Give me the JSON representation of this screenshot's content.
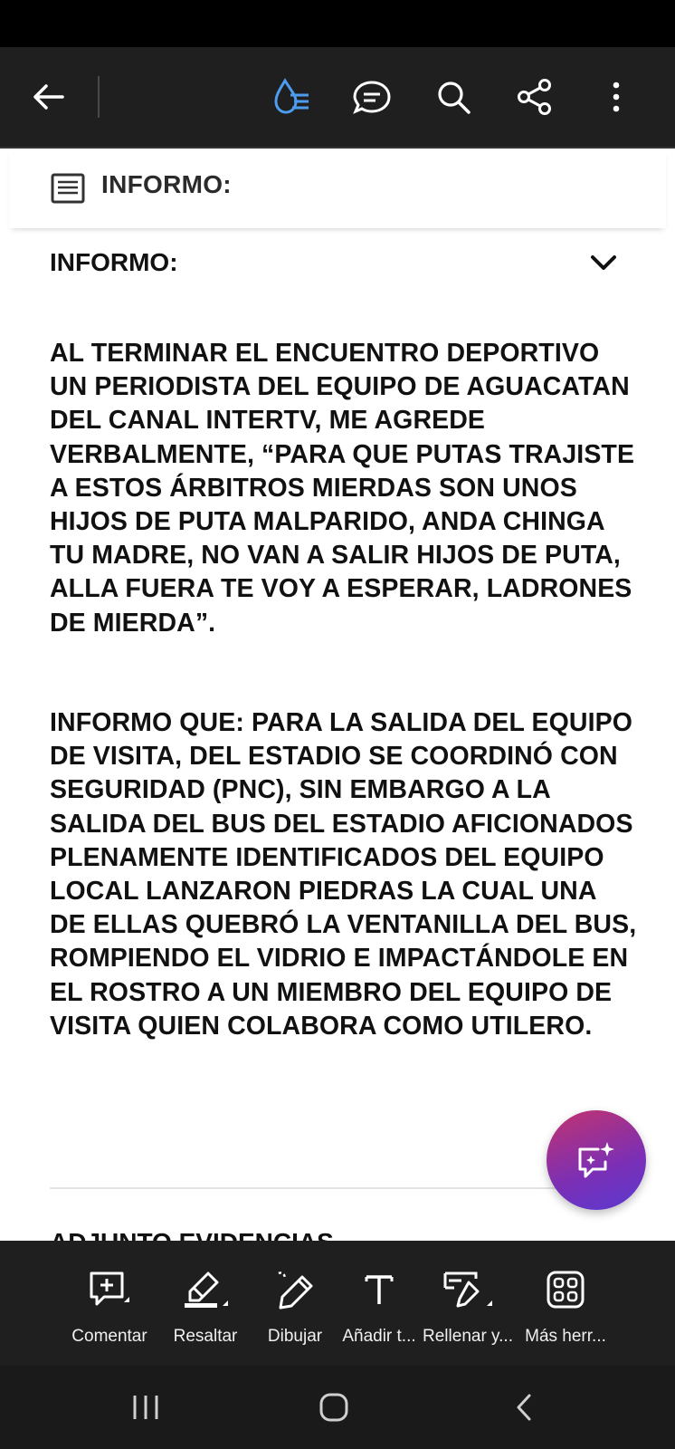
{
  "colors": {
    "topbar_bg": "#1f1f1f",
    "accent_blue": "#4c9cf0",
    "fab_gradient_start": "#c2336e",
    "fab_gradient_end": "#5a3ad0",
    "text": "#111111"
  },
  "topbar": {
    "icons": [
      "back-arrow-icon",
      "liquid-mode-icon",
      "comment-bubble-icon",
      "search-icon",
      "share-icon",
      "more-vertical-icon"
    ]
  },
  "doc_header": {
    "icon": "document-lines-icon",
    "title": "INFORMO:"
  },
  "content": {
    "section_title": "INFORMO:",
    "paragraph_1": "AL TERMINAR EL ENCUENTRO DEPORTIVO UN PERIODISTA DEL EQUIPO DE AGUACATAN DEL CANAL INTERTV, ME AGREDE VERBALMENTE, “PARA QUE PUTAS TRAJISTE A ESTOS ÁRBITROS MIERDAS SON UNOS HIJOS DE PUTA MALPARIDO, ANDA CHINGA TU MADRE, NO VAN A SALIR HIJOS DE PUTA, ALLA FUERA TE VOY A ESPERAR, LADRONES DE MIERDA”.",
    "paragraph_2": "INFORMO QUE: PARA LA SALIDA DEL EQUIPO DE VISITA, DEL ESTADIO SE COORDINÓ CON SEGURIDAD (PNC), SIN EMBARGO A LA SALIDA DEL BUS DEL ESTADIO AFICIONADOS PLENAMENTE IDENTIFICADOS DEL EQUIPO LOCAL LANZARON PIEDRAS LA CUAL UNA DE ELLAS QUEBRÓ LA VENTANILLA DEL BUS, ROMPIENDO EL VIDRIO E IMPACTÁNDOLE EN EL ROSTRO A UN MIEMBRO DEL EQUIPO DE VISITA QUIEN COLABORA COMO UTILERO.",
    "next_section_partial": "ADJUNTO EVIDENCIAS"
  },
  "bottom_toolbar": {
    "tools": [
      {
        "label": "Comentar",
        "icon": "add-comment-icon"
      },
      {
        "label": "Resaltar",
        "icon": "highlighter-icon"
      },
      {
        "label": "Dibujar",
        "icon": "draw-pencil-icon"
      },
      {
        "label": "Añadir t...",
        "icon": "text-tool-icon"
      },
      {
        "label": "Rellenar y...",
        "icon": "fill-sign-icon"
      },
      {
        "label": "Más herr...",
        "icon": "more-tools-grid-icon"
      }
    ]
  },
  "nav": {
    "buttons": [
      "recent-apps-icon",
      "home-icon",
      "back-nav-icon"
    ]
  }
}
